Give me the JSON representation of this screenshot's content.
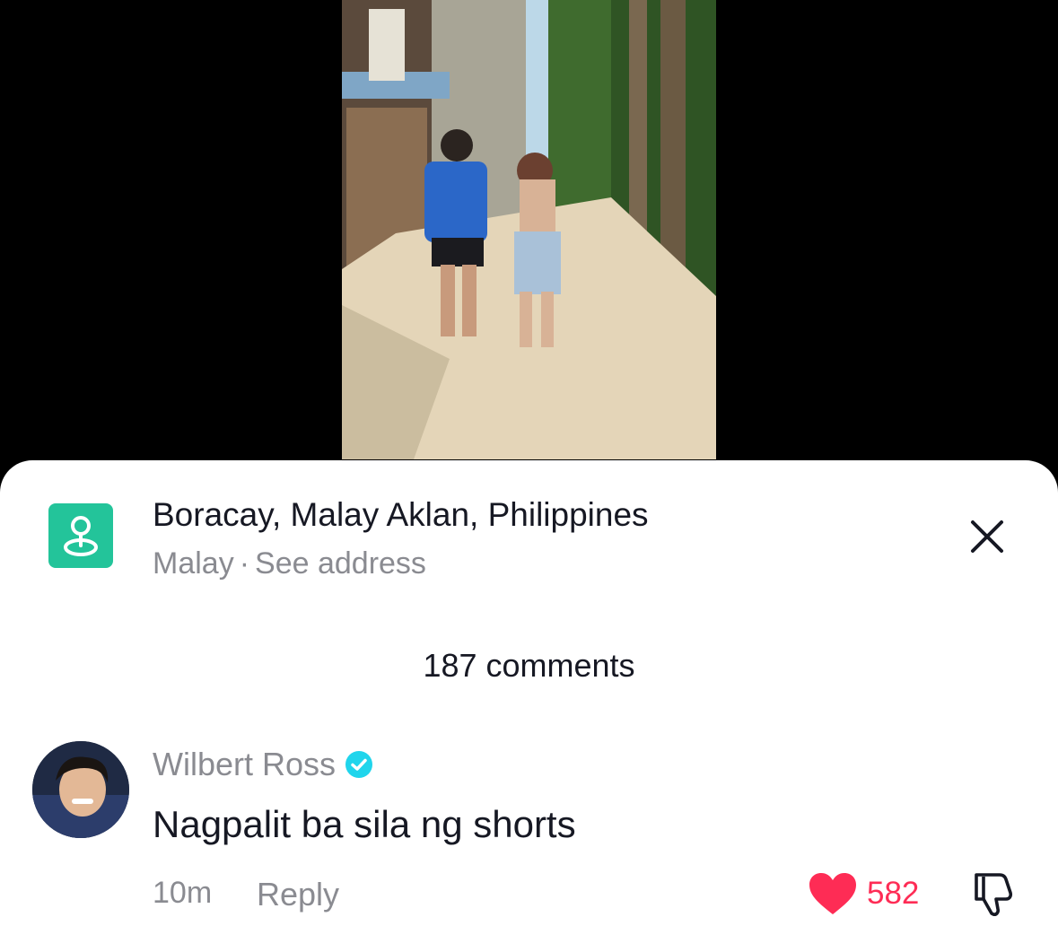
{
  "location": {
    "icon": "location-pin-icon",
    "title": "Boracay, Malay Aklan, Philippines",
    "city": "Malay",
    "separator": "·",
    "see_address_label": "See address"
  },
  "close_icon": "close-icon",
  "comments": {
    "count_label": "187 comments",
    "items": [
      {
        "username": "Wilbert Ross",
        "verified": true,
        "text": "Nagpalit ba sila ng shorts",
        "time": "10m",
        "reply_label": "Reply",
        "likes": "582",
        "liked": true
      }
    ]
  },
  "colors": {
    "location_icon_bg": "#23c49a",
    "like_red": "#fe2c55",
    "verified_blue": "#20d5ec",
    "muted_text": "#8a8b91",
    "primary_text": "#161823"
  }
}
